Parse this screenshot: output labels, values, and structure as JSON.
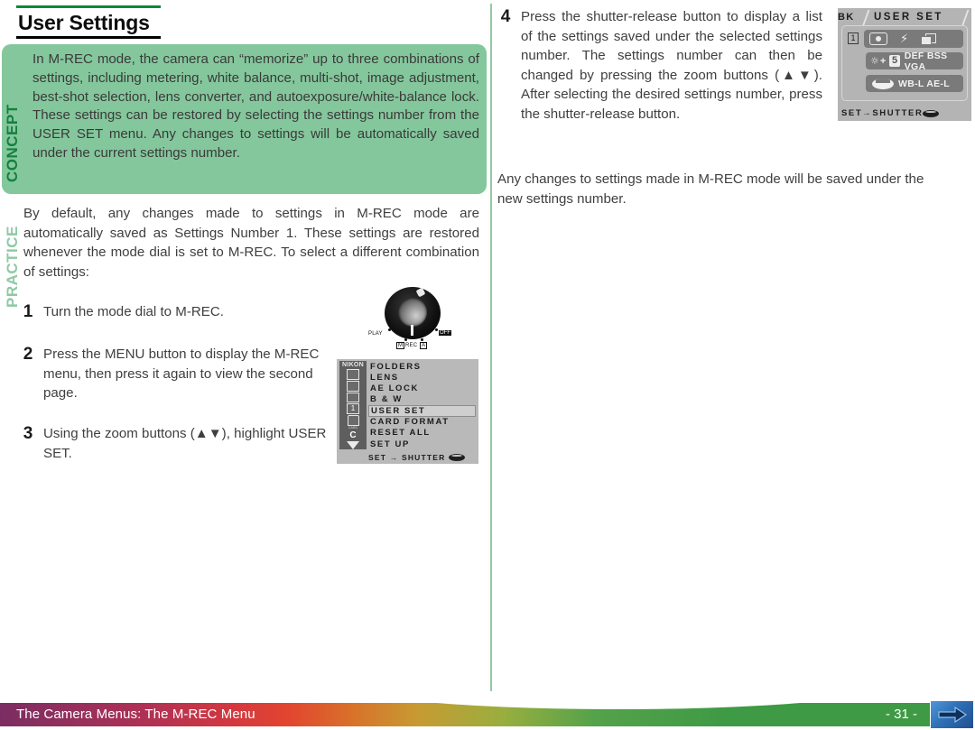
{
  "page": {
    "heading": "User Settings"
  },
  "concept": {
    "sidebar_label": "CONCEPT",
    "body": "In M-REC mode, the camera can “memorize” up to three combinations of settings, including metering, white balance, multi-shot, image adjustment, best-shot selection, lens converter, and autoexposure/white-balance lock.  These settings can be restored by selecting the settings number from the USER SET menu.  Any changes to settings will be automatically saved under the current settings number."
  },
  "practice": {
    "sidebar_label": "PRACTICE",
    "intro": "By default, any changes made to settings in M-REC mode are automatically saved as Settings Number 1.  These settings are restored whenever the mode dial is set to M-REC.  To select a different combination of settings:",
    "steps": [
      {
        "num": "1",
        "text": "Turn the mode dial to M-REC."
      },
      {
        "num": "2",
        "text": "Press the MENU button to display the M-REC menu, then press it again to view the second page."
      },
      {
        "num": "3",
        "text": "Using the zoom buttons (▲▼), highlight USER SET."
      },
      {
        "num": "4",
        "text": "Press the shutter-release button to display a list of the settings saved under the selected settings number.  The settings number can then be changed by pressing the zoom buttons (▲▼).  After selecting the desired settings number, press the shutter-release button."
      }
    ],
    "closing": "Any changes to settings made in M-REC mode will be saved under the new settings number."
  },
  "mode_dial": {
    "labels": {
      "play": "PLAY",
      "off": "OFF",
      "m": "M",
      "rec": "REC",
      "a": "A"
    }
  },
  "mrec_menu_lcd": {
    "brand": "NIKON",
    "icon_column": {
      "settings_number": "1",
      "card_label": "CARD",
      "custom_label": "C"
    },
    "items": [
      {
        "label": "FOLDERS",
        "selected": false
      },
      {
        "label": "LENS",
        "selected": false
      },
      {
        "label": "AE LOCK",
        "selected": false
      },
      {
        "label": "B & W",
        "selected": false
      },
      {
        "label": "USER SET",
        "selected": true
      },
      {
        "label": "CARD FORMAT",
        "selected": false
      },
      {
        "label": "RESET ALL",
        "selected": false
      },
      {
        "label": "SET UP",
        "selected": false
      }
    ],
    "footer": "SET → SHUTTER"
  },
  "user_set_lcd": {
    "tab_left": "BK",
    "title": "USER SET",
    "settings_number": "1",
    "row2_text": "DEF BSS VGA",
    "row2_bw": "5",
    "row3_text": "WB-L AE-L",
    "footer": "SET→SHUTTER"
  },
  "footer": {
    "title": "The Camera Menus: The M-REC Menu",
    "page_number": "- 31 -",
    "next_icon": "right-arrow-icon"
  },
  "colors": {
    "concept_box": "#84c79c",
    "concept_label": "#15803d",
    "practice_label": "#8fc9a4",
    "title_rule_top": "#0a8a3c",
    "title_rule_bottom": "#000000",
    "divider": "#96c9a6",
    "lcd_background": "#b9b9b9",
    "lcd_icon_column": "#5e5e5e",
    "next_button": "#2f6fb5"
  }
}
